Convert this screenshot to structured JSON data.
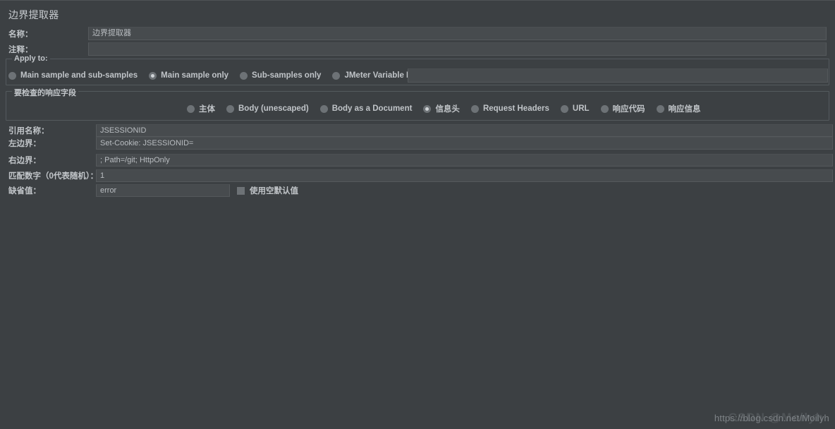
{
  "panel": {
    "title": "边界提取器"
  },
  "fields": {
    "name_label": "名称：",
    "name_value": "边界提取器",
    "comment_label": "注释：",
    "comment_value": ""
  },
  "apply_to": {
    "group_title": "Apply to:",
    "options": [
      {
        "label": "Main sample and sub-samples",
        "selected": false
      },
      {
        "label": "Main sample only",
        "selected": true
      },
      {
        "label": "Sub-samples only",
        "selected": false
      },
      {
        "label": "JMeter Variable Name to use",
        "selected": false
      }
    ],
    "variable_value": ""
  },
  "response_field": {
    "group_title": "要检查的响应字段",
    "options": [
      {
        "label": "主体",
        "selected": false
      },
      {
        "label": "Body (unescaped)",
        "selected": false
      },
      {
        "label": "Body as a Document",
        "selected": false
      },
      {
        "label": "信息头",
        "selected": true
      },
      {
        "label": "Request Headers",
        "selected": false
      },
      {
        "label": "URL",
        "selected": false
      },
      {
        "label": "响应代码",
        "selected": false
      },
      {
        "label": "响应信息",
        "selected": false
      }
    ]
  },
  "extractor": {
    "reference_name_label": "引用名称：",
    "reference_name_value": "JSESSIONID",
    "left_boundary_label": "左边界：",
    "left_boundary_value": "Set-Cookie: JSESSIONID=",
    "right_boundary_label": "右边界：",
    "right_boundary_value": "; Path=/git; HttpOnly",
    "match_number_label": "匹配数字（0代表随机）：",
    "match_number_value": "1",
    "default_value_label": "缺省值：",
    "default_value_value": "error",
    "use_empty_default_label": "使用空默认值",
    "use_empty_default_checked": false
  },
  "watermark": {
    "url": "https://blog.csdn.net/Moilyh",
    "ghost": "CSDN @Moilyh"
  }
}
